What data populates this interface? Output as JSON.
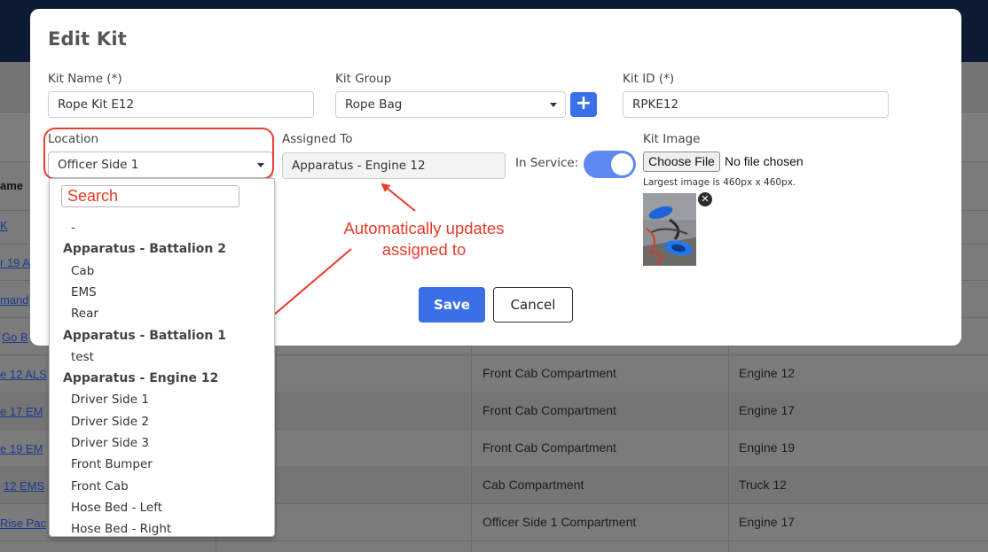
{
  "background": {
    "table_header": "ame",
    "links": [
      "K",
      "r 19 A",
      "mand",
      "Go B",
      "e 12 ALS",
      "e 17 EM",
      "e 19 EM",
      "12 EMS",
      "Rise Pac"
    ],
    "rows": [
      {
        "compartment": "Front Cab Compartment",
        "apparatus": "Engine 12"
      },
      {
        "compartment": "Front Cab Compartment",
        "apparatus": "Engine 17"
      },
      {
        "compartment": "Front Cab Compartment",
        "apparatus": "Engine 19"
      },
      {
        "compartment": "Cab Compartment",
        "apparatus": "Truck 12"
      },
      {
        "compartment": "Officer Side 1 Compartment",
        "apparatus": "Engine 17"
      }
    ]
  },
  "modal": {
    "title": "Edit Kit",
    "kit_name": {
      "label": "Kit Name (*)",
      "value": "Rope Kit E12"
    },
    "kit_group": {
      "label": "Kit Group",
      "value": "Rope Bag",
      "add_icon": "plus-icon"
    },
    "kit_id": {
      "label": "Kit ID (*)",
      "value": "RPKE12"
    },
    "location": {
      "label": "Location",
      "value": "Officer Side 1"
    },
    "assigned_to": {
      "label": "Assigned To",
      "value": "Apparatus - Engine 12"
    },
    "in_service": {
      "label": "In Service:",
      "on": true
    },
    "kit_image": {
      "label": "Kit Image",
      "choose_file": "Choose File",
      "file_status": "No file chosen",
      "hint": "Largest image is 460px x 460px.",
      "remove_icon": "close-icon"
    },
    "save_label": "Save",
    "cancel_label": "Cancel"
  },
  "annotation": {
    "line1": "Automatically updates",
    "line2": "assigned to",
    "color": "#e63b27"
  },
  "dropdown": {
    "search": "Search",
    "items": [
      {
        "type": "option",
        "label": "-"
      },
      {
        "type": "group",
        "label": "Apparatus - Battalion 2"
      },
      {
        "type": "option",
        "label": "Cab"
      },
      {
        "type": "option",
        "label": "EMS"
      },
      {
        "type": "option",
        "label": "Rear"
      },
      {
        "type": "group",
        "label": "Apparatus - Battalion 1"
      },
      {
        "type": "option",
        "label": "test"
      },
      {
        "type": "group",
        "label": "Apparatus - Engine 12"
      },
      {
        "type": "option",
        "label": "Driver Side 1"
      },
      {
        "type": "option",
        "label": "Driver Side 2"
      },
      {
        "type": "option",
        "label": "Driver Side 3"
      },
      {
        "type": "option",
        "label": "Front Bumper"
      },
      {
        "type": "option",
        "label": "Front Cab"
      },
      {
        "type": "option",
        "label": "Hose Bed - Left"
      },
      {
        "type": "option",
        "label": "Hose Bed - Right"
      }
    ]
  },
  "colors": {
    "primary": "#3a6fe8",
    "toggle_on": "#5e89f0",
    "annotation_red": "#e63b27",
    "navbar": "#0c1a33"
  }
}
